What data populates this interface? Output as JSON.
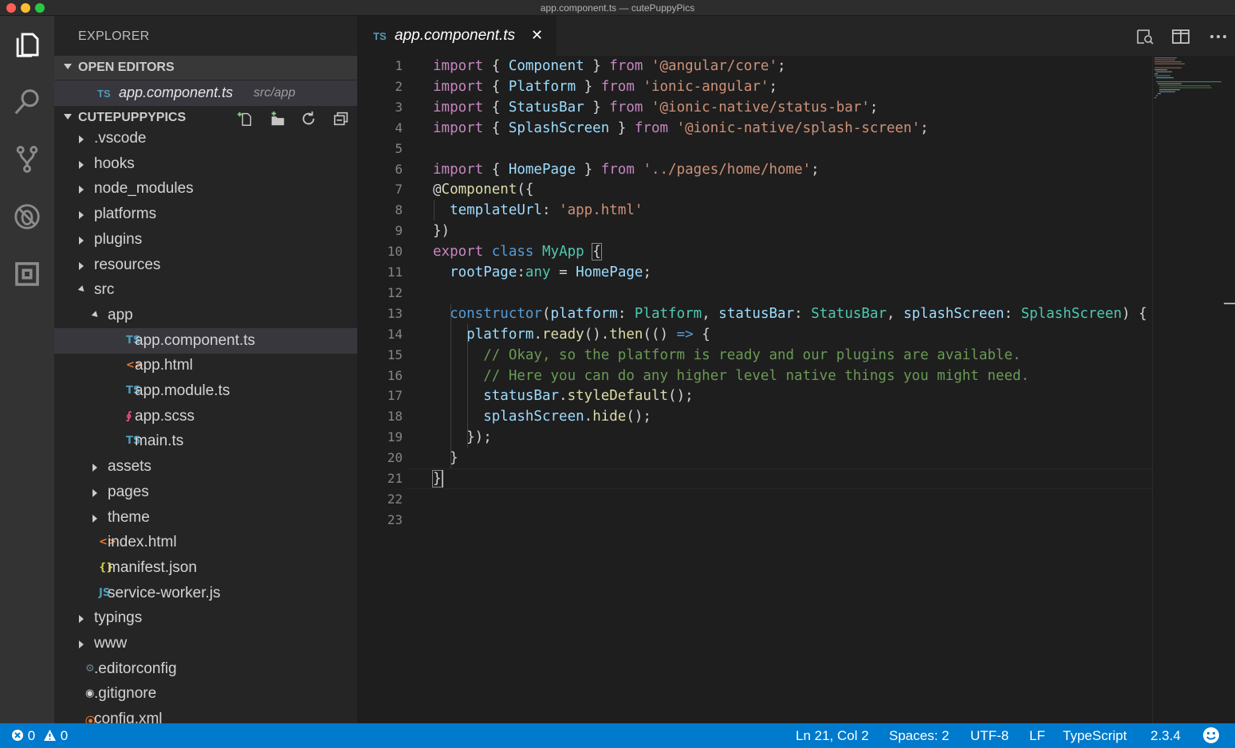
{
  "window": {
    "title": "app.component.ts — cutePuppyPics"
  },
  "activity_bar": [
    {
      "name": "explorer-icon"
    },
    {
      "name": "search-icon"
    },
    {
      "name": "source-control-icon"
    },
    {
      "name": "debug-icon"
    },
    {
      "name": "extensions-icon"
    }
  ],
  "sidebar": {
    "title": "EXPLORER",
    "open_editors": {
      "header": "OPEN EDITORS",
      "items": [
        {
          "icon_text": "TS",
          "name": "app.component.ts",
          "path": "src/app"
        }
      ]
    },
    "project": {
      "header": "CUTEPUPPYPICS",
      "actions": [
        "new-file-icon",
        "new-folder-icon",
        "refresh-icon",
        "collapse-all-icon"
      ]
    },
    "tree": [
      {
        "label": ".vscode",
        "kind": "folder",
        "depth": 0,
        "open": false
      },
      {
        "label": "hooks",
        "kind": "folder",
        "depth": 0,
        "open": false
      },
      {
        "label": "node_modules",
        "kind": "folder",
        "depth": 0,
        "open": false
      },
      {
        "label": "platforms",
        "kind": "folder",
        "depth": 0,
        "open": false
      },
      {
        "label": "plugins",
        "kind": "folder",
        "depth": 0,
        "open": false
      },
      {
        "label": "resources",
        "kind": "folder",
        "depth": 0,
        "open": false
      },
      {
        "label": "src",
        "kind": "folder",
        "depth": 0,
        "open": true
      },
      {
        "label": "app",
        "kind": "folder",
        "depth": 1,
        "open": true
      },
      {
        "label": "app.component.ts",
        "kind": "file",
        "depth": 2,
        "icon": "TS",
        "icon_color": "#519aba",
        "selected": true
      },
      {
        "label": "app.html",
        "kind": "file",
        "depth": 2,
        "icon": "<>",
        "icon_color": "#e37933"
      },
      {
        "label": "app.module.ts",
        "kind": "file",
        "depth": 2,
        "icon": "TS",
        "icon_color": "#519aba"
      },
      {
        "label": "app.scss",
        "kind": "file",
        "depth": 2,
        "icon": "∮",
        "icon_color": "#f55385"
      },
      {
        "label": "main.ts",
        "kind": "file",
        "depth": 2,
        "icon": "TS",
        "icon_color": "#519aba"
      },
      {
        "label": "assets",
        "kind": "folder",
        "depth": 1,
        "open": false
      },
      {
        "label": "pages",
        "kind": "folder",
        "depth": 1,
        "open": false
      },
      {
        "label": "theme",
        "kind": "folder",
        "depth": 1,
        "open": false
      },
      {
        "label": "index.html",
        "kind": "file",
        "depth": 1,
        "icon": "<>",
        "icon_color": "#e37933"
      },
      {
        "label": "manifest.json",
        "kind": "file",
        "depth": 1,
        "icon": "{}",
        "icon_color": "#cbcb41"
      },
      {
        "label": "service-worker.js",
        "kind": "file",
        "depth": 1,
        "icon": "JS",
        "icon_color": "#519aba"
      },
      {
        "label": "typings",
        "kind": "folder",
        "depth": 0,
        "open": false
      },
      {
        "label": "www",
        "kind": "folder",
        "depth": 0,
        "open": false
      },
      {
        "label": ".editorconfig",
        "kind": "file",
        "depth": 0,
        "icon": "⚙",
        "icon_color": "#6d8086"
      },
      {
        "label": ".gitignore",
        "kind": "file",
        "depth": 0,
        "icon": "◉",
        "icon_color": "#d4d4d4"
      },
      {
        "label": "config.xml",
        "kind": "file",
        "depth": 0,
        "icon": "⦿",
        "icon_color": "#e37933"
      }
    ]
  },
  "editor": {
    "tab": {
      "icon_text": "TS",
      "label": "app.component.ts",
      "close": "✕"
    },
    "actions": [
      "open-preview-icon",
      "split-editor-icon",
      "more-actions-icon"
    ],
    "code_lines": [
      [
        [
          "kw",
          "import"
        ],
        [
          "pu",
          " { "
        ],
        [
          "va",
          "Component"
        ],
        [
          "pu",
          " } "
        ],
        [
          "kw",
          "from"
        ],
        [
          "pu",
          " "
        ],
        [
          "str",
          "'@angular/core'"
        ],
        [
          "pu",
          ";"
        ]
      ],
      [
        [
          "kw",
          "import"
        ],
        [
          "pu",
          " { "
        ],
        [
          "va",
          "Platform"
        ],
        [
          "pu",
          " } "
        ],
        [
          "kw",
          "from"
        ],
        [
          "pu",
          " "
        ],
        [
          "str",
          "'ionic-angular'"
        ],
        [
          "pu",
          ";"
        ]
      ],
      [
        [
          "kw",
          "import"
        ],
        [
          "pu",
          " { "
        ],
        [
          "va",
          "StatusBar"
        ],
        [
          "pu",
          " } "
        ],
        [
          "kw",
          "from"
        ],
        [
          "pu",
          " "
        ],
        [
          "str",
          "'@ionic-native/status-bar'"
        ],
        [
          "pu",
          ";"
        ]
      ],
      [
        [
          "kw",
          "import"
        ],
        [
          "pu",
          " { "
        ],
        [
          "va",
          "SplashScreen"
        ],
        [
          "pu",
          " } "
        ],
        [
          "kw",
          "from"
        ],
        [
          "pu",
          " "
        ],
        [
          "str",
          "'@ionic-native/splash-screen'"
        ],
        [
          "pu",
          ";"
        ]
      ],
      [],
      [
        [
          "kw",
          "import"
        ],
        [
          "pu",
          " { "
        ],
        [
          "va",
          "HomePage"
        ],
        [
          "pu",
          " } "
        ],
        [
          "kw",
          "from"
        ],
        [
          "pu",
          " "
        ],
        [
          "str",
          "'../pages/home/home'"
        ],
        [
          "pu",
          ";"
        ]
      ],
      [
        [
          "pu",
          "@"
        ],
        [
          "fn",
          "Component"
        ],
        [
          "pu",
          "({"
        ]
      ],
      [
        [
          "pu",
          "  "
        ],
        [
          "va",
          "templateUrl"
        ],
        [
          "pu",
          ": "
        ],
        [
          "str",
          "'app.html'"
        ]
      ],
      [
        [
          "pu",
          "})"
        ]
      ],
      [
        [
          "kw",
          "export"
        ],
        [
          "pu",
          " "
        ],
        [
          "kb",
          "class"
        ],
        [
          "pu",
          " "
        ],
        [
          "ty",
          "MyApp"
        ],
        [
          "pu",
          " "
        ],
        [
          "brk",
          "{"
        ]
      ],
      [
        [
          "pu",
          "  "
        ],
        [
          "va",
          "rootPage"
        ],
        [
          "pu",
          ":"
        ],
        [
          "ty",
          "any"
        ],
        [
          "pu",
          " = "
        ],
        [
          "va",
          "HomePage"
        ],
        [
          "pu",
          ";"
        ]
      ],
      [],
      [
        [
          "pu",
          "  "
        ],
        [
          "kb",
          "constructor"
        ],
        [
          "pu",
          "("
        ],
        [
          "va",
          "platform"
        ],
        [
          "pu",
          ": "
        ],
        [
          "ty",
          "Platform"
        ],
        [
          "pu",
          ", "
        ],
        [
          "va",
          "statusBar"
        ],
        [
          "pu",
          ": "
        ],
        [
          "ty",
          "StatusBar"
        ],
        [
          "pu",
          ", "
        ],
        [
          "va",
          "splashScreen"
        ],
        [
          "pu",
          ": "
        ],
        [
          "ty",
          "SplashScreen"
        ],
        [
          "pu",
          ") {"
        ]
      ],
      [
        [
          "pu",
          "    "
        ],
        [
          "va",
          "platform"
        ],
        [
          "pu",
          "."
        ],
        [
          "fn",
          "ready"
        ],
        [
          "pu",
          "()."
        ],
        [
          "fn",
          "then"
        ],
        [
          "pu",
          "(() "
        ],
        [
          "kb",
          "=>"
        ],
        [
          "pu",
          " {"
        ]
      ],
      [
        [
          "pu",
          "      "
        ],
        [
          "cm",
          "// Okay, so the platform is ready and our plugins are available."
        ]
      ],
      [
        [
          "pu",
          "      "
        ],
        [
          "cm",
          "// Here you can do any higher level native things you might need."
        ]
      ],
      [
        [
          "pu",
          "      "
        ],
        [
          "va",
          "statusBar"
        ],
        [
          "pu",
          "."
        ],
        [
          "fn",
          "styleDefault"
        ],
        [
          "pu",
          "();"
        ]
      ],
      [
        [
          "pu",
          "      "
        ],
        [
          "va",
          "splashScreen"
        ],
        [
          "pu",
          "."
        ],
        [
          "fn",
          "hide"
        ],
        [
          "pu",
          "();"
        ]
      ],
      [
        [
          "pu",
          "    });"
        ]
      ],
      [
        [
          "pu",
          "  }"
        ]
      ],
      [
        [
          "brk",
          "}"
        ]
      ],
      [],
      []
    ],
    "current_line": 21
  },
  "status_bar": {
    "errors": "0",
    "warnings": "0",
    "position": "Ln 21, Col 2",
    "spaces": "Spaces: 2",
    "encoding": "UTF-8",
    "eol": "LF",
    "language": "TypeScript",
    "version": "2.3.4",
    "feedback_icon": "smiley-icon"
  }
}
